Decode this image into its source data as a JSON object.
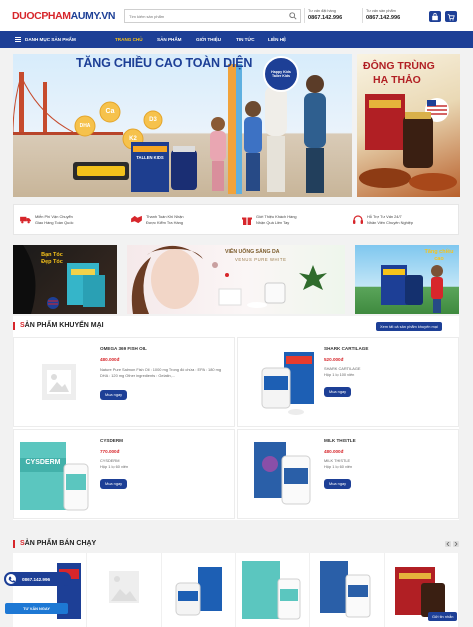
{
  "brand": {
    "logo_part1": "DUOCPHAM",
    "logo_part2": "AUMY.VN",
    "accent_red": "#d7262b",
    "accent_blue": "#1d3f96"
  },
  "header": {
    "search_placeholder": "Tìm kiếm sản phẩm",
    "hotline_1_label": "Tư vấn đặt hàng",
    "hotline_1_number": "0867.142.996",
    "hotline_2_label": "Tư vấn sản phẩm",
    "hotline_2_number": "0867.142.996"
  },
  "nav": {
    "categories_label": "DANH MỤC SẢN PHẨM",
    "items": [
      "TRANG CHỦ",
      "SẢN PHẨM",
      "GIỚI THIỆU",
      "TIN TỨC",
      "LIÊN HỆ"
    ]
  },
  "hero": {
    "main_headline": "TĂNG CHIỀU CAO TOÀN DIỆN",
    "main_product": "TALLEN KIDS",
    "badge_text": "Happy Kids Taller Kids",
    "bubbles": [
      "DHA",
      "Ca",
      "K2",
      "D3"
    ],
    "side_headline_1": "ĐÔNG TRÙNG",
    "side_headline_2": "HẠ THẢO"
  },
  "features": [
    {
      "line1": "Miễn Phí Vận Chuyển",
      "line2": "Giao Hàng Toàn Quốc"
    },
    {
      "line1": "Thanh Toán Khi Nhận",
      "line2": "Được Kiểm Tra Hàng"
    },
    {
      "line1": "Giới Thiệu Khách Hàng",
      "line2": "Nhận Quà Liền Tay"
    },
    {
      "line1": "Hỗ Trợ Tư Vấn 24/7",
      "line2": "Nhân Viên Chuyên Nghiệp"
    }
  ],
  "sub_banners": {
    "hair_label": "Bạn Tóc Đẹp Tóc",
    "white_headline": "VIÊN UỐNG SÁNG DA",
    "white_sub": "VENUS PURE WHITE",
    "kids_label": "Tăng chiều cao"
  },
  "promo": {
    "title_prefix": "S",
    "title_rest": "ẢN PHẨM KHUYẾN MẠI",
    "view_all": "Xem tất cả sản phẩm khuyến mại",
    "products": [
      {
        "name": "OMEGA 369 FISH OIL",
        "price": "480.000đ",
        "desc": "Nature Pure Salmon Fish Oil : 1000 mg Trong đó chứa : EPA : 180 mg DHA : 120 mg Other ingredients : Gelatin,...",
        "buy": "Mua ngay"
      },
      {
        "name": "SHARK CARTILAGE",
        "price": "520.000đ",
        "desc": "SHARK CARTILAGE\nHộp 1 lọ 100 viên",
        "buy": "Mua ngay"
      },
      {
        "name": "CYSDERM",
        "price": "770.000đ",
        "desc": "CYSDERM\nHộp 1 lọ 60 viên",
        "buy": "Mua ngay",
        "label": "CYSDERM"
      },
      {
        "name": "MILK THISTLE",
        "price": "480.000đ",
        "desc": "MILK THISTLE\nHộp 1 lọ 60 viên",
        "buy": "Mua ngay"
      }
    ]
  },
  "best": {
    "title_prefix": "S",
    "title_rest": "ẢN PHẨM BÁN CHẠY"
  },
  "floating": {
    "phone": "0867.142.996",
    "consult": "TƯ VẤN NGAY",
    "chat": "Gửi tin nhắn"
  }
}
